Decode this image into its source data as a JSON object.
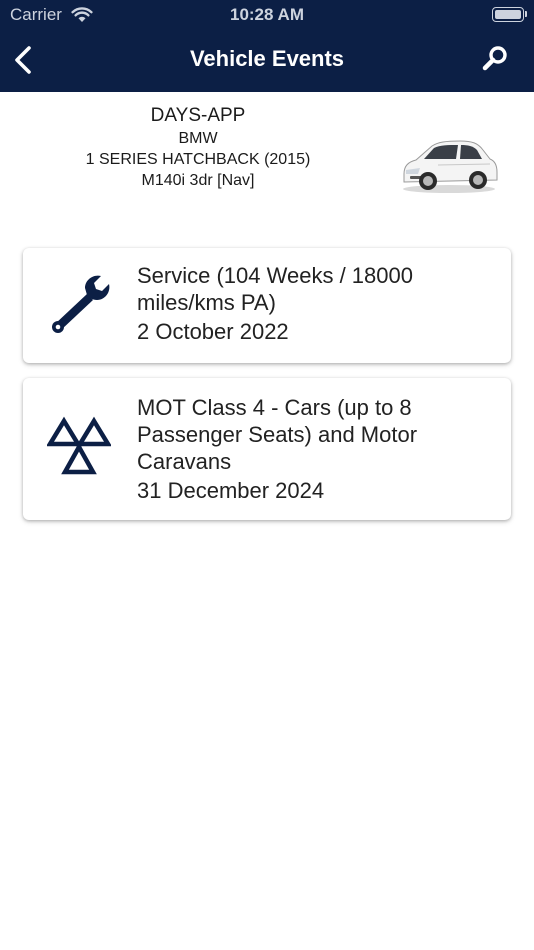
{
  "status_bar": {
    "carrier": "Carrier",
    "time": "10:28 AM",
    "wifi_icon": "wifi-icon",
    "battery_icon": "battery-icon"
  },
  "nav": {
    "title": "Vehicle Events",
    "back_icon": "chevron-left-icon",
    "search_icon": "search-icon",
    "background_color": "#0c1f45"
  },
  "vehicle": {
    "registration": "DAYS-APP",
    "make": "BMW",
    "model": "1 SERIES HATCHBACK (2015)",
    "variant": "M140i 3dr [Nav]",
    "image": "car-image"
  },
  "events": [
    {
      "icon": "wrench-icon",
      "name": "Service (104 Weeks / 18000 miles/kms PA)",
      "date": "2 October 2022"
    },
    {
      "icon": "mot-triangles-icon",
      "name": "MOT Class 4 - Cars (up to 8 Passenger Seats) and Motor Caravans",
      "date": "31 December 2024"
    }
  ],
  "colors": {
    "header": "#0c1f45",
    "icon": "#0c1f45",
    "text": "#222222"
  }
}
